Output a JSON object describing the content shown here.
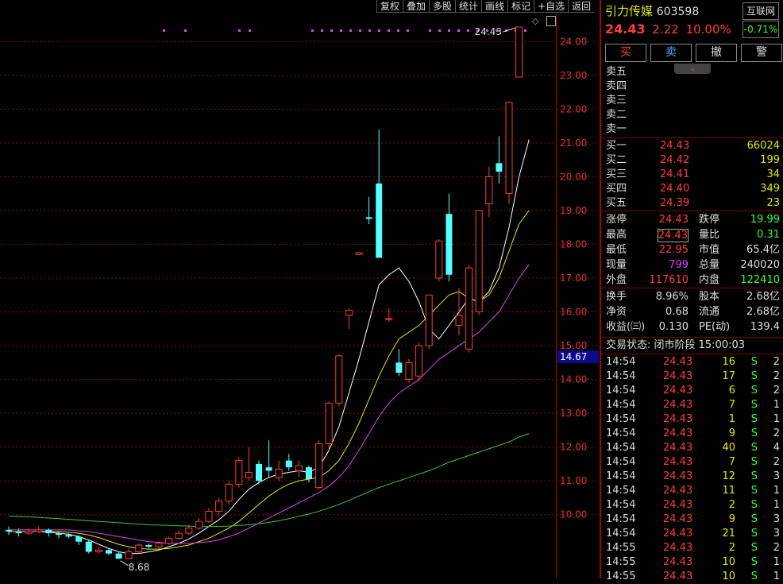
{
  "toolbar": [
    "复权",
    "叠加",
    "多股",
    "统计",
    "画线",
    "标记",
    "+自选",
    "返回"
  ],
  "stock": {
    "name": "引力传媒",
    "code": "603598",
    "price": "24.43",
    "change": "2.22",
    "pct": "10.00%",
    "index_name": "互联网",
    "index_pct": "-0.71%"
  },
  "trade_buttons": [
    "买",
    "卖",
    "撤",
    "警"
  ],
  "sell_levels": [
    "卖五",
    "卖四",
    "卖三",
    "卖二",
    "卖一"
  ],
  "buy_levels": [
    {
      "label": "买一",
      "price": "24.43",
      "vol": "66024"
    },
    {
      "label": "买二",
      "price": "24.42",
      "vol": "199"
    },
    {
      "label": "买三",
      "price": "24.41",
      "vol": "34"
    },
    {
      "label": "买四",
      "price": "24.40",
      "vol": "349"
    },
    {
      "label": "买五",
      "price": "24.39",
      "vol": "23"
    }
  ],
  "stats1": [
    {
      "k1": "涨停",
      "v1": "24.43",
      "c1": "red",
      "k2": "跌停",
      "v2": "19.99",
      "c2": "green"
    },
    {
      "k1": "最高",
      "v1": "24.43",
      "c1": "red",
      "k2": "量比",
      "v2": "0.31",
      "c2": "green"
    },
    {
      "k1": "最低",
      "v1": "22.95",
      "c1": "red",
      "k2": "市值",
      "v2": "65.4亿",
      "c2": "white"
    },
    {
      "k1": "现量",
      "v1": "799",
      "c1": "purple",
      "k2": "总量",
      "v2": "240020",
      "c2": "white"
    },
    {
      "k1": "外盘",
      "v1": "117610",
      "c1": "red",
      "k2": "内盘",
      "v2": "122410",
      "c2": "green"
    }
  ],
  "stats2": [
    {
      "k1": "换手",
      "v1": "8.96%",
      "k2": "股本",
      "v2": "2.68亿"
    },
    {
      "k1": "净资",
      "v1": "0.68",
      "k2": "流通",
      "v2": "2.68亿"
    },
    {
      "k1": "收益(㈢)",
      "v1": "0.130",
      "k2": "PE(动)",
      "v2": "139.4"
    }
  ],
  "trade_status": "交易状态: 闭市阶段 15:00:03",
  "ticks": [
    {
      "t": "14:54",
      "p": "24.43",
      "v": "16",
      "s": "S",
      "n": "2"
    },
    {
      "t": "14:54",
      "p": "24.43",
      "v": "17",
      "s": "S",
      "n": "2"
    },
    {
      "t": "14:54",
      "p": "24.43",
      "v": "6",
      "s": "S",
      "n": "2"
    },
    {
      "t": "14:54",
      "p": "24.43",
      "v": "7",
      "s": "S",
      "n": "1"
    },
    {
      "t": "14:54",
      "p": "24.43",
      "v": "1",
      "s": "S",
      "n": "1"
    },
    {
      "t": "14:54",
      "p": "24.43",
      "v": "9",
      "s": "S",
      "n": "2"
    },
    {
      "t": "14:54",
      "p": "24.43",
      "v": "40",
      "s": "S",
      "n": "4"
    },
    {
      "t": "14:54",
      "p": "24.43",
      "v": "7",
      "s": "S",
      "n": "2"
    },
    {
      "t": "14:54",
      "p": "24.43",
      "v": "12",
      "s": "S",
      "n": "3"
    },
    {
      "t": "14:54",
      "p": "24.43",
      "v": "11",
      "s": "S",
      "n": "1"
    },
    {
      "t": "14:54",
      "p": "24.43",
      "v": "2",
      "s": "S",
      "n": "1"
    },
    {
      "t": "14:54",
      "p": "24.43",
      "v": "9",
      "s": "S",
      "n": "3"
    },
    {
      "t": "14:54",
      "p": "24.43",
      "v": "21",
      "s": "S",
      "n": "3"
    },
    {
      "t": "14:55",
      "p": "24.43",
      "v": "2",
      "s": "S",
      "n": "2"
    },
    {
      "t": "14:55",
      "p": "24.43",
      "v": "10",
      "s": "S",
      "n": "1"
    },
    {
      "t": "14:55",
      "p": "24.43",
      "v": "10",
      "s": "S",
      "n": "1"
    }
  ],
  "chart_data": {
    "type": "candlestick",
    "y_ticks": [
      10,
      11,
      12,
      13,
      14,
      15,
      16,
      17,
      18,
      19,
      20,
      21,
      22,
      23,
      24
    ],
    "ylim": [
      8.3,
      24.9
    ],
    "crosshair_price": "14.67",
    "high_label": "24.43",
    "low_label": "8.68",
    "candles": [
      {
        "o": 9.55,
        "c": 9.5,
        "h": 9.65,
        "l": 9.4
      },
      {
        "o": 9.5,
        "c": 9.45,
        "h": 9.6,
        "l": 9.35
      },
      {
        "o": 9.45,
        "c": 9.5,
        "h": 9.6,
        "l": 9.4
      },
      {
        "o": 9.5,
        "c": 9.55,
        "h": 9.65,
        "l": 9.45
      },
      {
        "o": 9.55,
        "c": 9.45,
        "h": 9.6,
        "l": 9.35
      },
      {
        "o": 9.45,
        "c": 9.4,
        "h": 9.5,
        "l": 9.3
      },
      {
        "o": 9.4,
        "c": 9.35,
        "h": 9.45,
        "l": 9.3
      },
      {
        "o": 9.35,
        "c": 9.2,
        "h": 9.4,
        "l": 9.1
      },
      {
        "o": 9.2,
        "c": 8.9,
        "h": 9.25,
        "l": 8.85
      },
      {
        "o": 8.9,
        "c": 8.95,
        "h": 9.05,
        "l": 8.85
      },
      {
        "o": 8.95,
        "c": 8.85,
        "h": 9.0,
        "l": 8.8
      },
      {
        "o": 8.85,
        "c": 8.7,
        "h": 8.9,
        "l": 8.68
      },
      {
        "o": 8.7,
        "c": 8.9,
        "h": 9.0,
        "l": 8.68
      },
      {
        "o": 8.9,
        "c": 9.1,
        "h": 9.15,
        "l": 8.85
      },
      {
        "o": 9.1,
        "c": 9.05,
        "h": 9.15,
        "l": 9.0
      },
      {
        "o": 9.05,
        "c": 9.15,
        "h": 9.2,
        "l": 9.0
      },
      {
        "o": 9.15,
        "c": 9.3,
        "h": 9.35,
        "l": 9.1
      },
      {
        "o": 9.3,
        "c": 9.45,
        "h": 9.55,
        "l": 9.25
      },
      {
        "o": 9.45,
        "c": 9.6,
        "h": 9.7,
        "l": 9.4
      },
      {
        "o": 9.6,
        "c": 9.8,
        "h": 9.9,
        "l": 9.55
      },
      {
        "o": 9.8,
        "c": 10.1,
        "h": 10.2,
        "l": 9.75
      },
      {
        "o": 10.1,
        "c": 10.4,
        "h": 10.5,
        "l": 10.0
      },
      {
        "o": 10.4,
        "c": 10.9,
        "h": 11.0,
        "l": 10.3
      },
      {
        "o": 10.9,
        "c": 11.6,
        "h": 11.7,
        "l": 10.8
      },
      {
        "o": 11.1,
        "c": 11.25,
        "h": 12.0,
        "l": 11.0
      },
      {
        "o": 11.5,
        "c": 11.0,
        "h": 11.6,
        "l": 10.9
      },
      {
        "o": 11.4,
        "c": 11.3,
        "h": 12.2,
        "l": 11.1
      },
      {
        "o": 11.1,
        "c": 11.35,
        "h": 11.6,
        "l": 11.0
      },
      {
        "o": 11.6,
        "c": 11.4,
        "h": 11.8,
        "l": 11.3
      },
      {
        "o": 11.3,
        "c": 11.45,
        "h": 11.6,
        "l": 11.1
      },
      {
        "o": 11.4,
        "c": 11.05,
        "h": 11.45,
        "l": 10.95
      },
      {
        "o": 10.8,
        "c": 12.1,
        "h": 12.2,
        "l": 10.75
      },
      {
        "o": 12.1,
        "c": 13.3,
        "h": 13.35,
        "l": 11.9
      },
      {
        "o": 13.3,
        "c": 14.7,
        "h": 14.75,
        "l": 13.2
      },
      {
        "o": 15.9,
        "c": 16.05,
        "h": 16.1,
        "l": 15.5
      },
      {
        "o": 17.7,
        "c": 17.75,
        "h": 17.75,
        "l": 17.7
      },
      {
        "o": 18.8,
        "c": 18.75,
        "h": 19.4,
        "l": 18.6
      },
      {
        "o": 19.8,
        "c": 17.6,
        "h": 21.4,
        "l": 17.6
      },
      {
        "o": 15.8,
        "c": 15.8,
        "h": 16.1,
        "l": 15.7
      },
      {
        "o": 14.5,
        "c": 14.2,
        "h": 14.9,
        "l": 14.1
      },
      {
        "o": 14.0,
        "c": 14.5,
        "h": 14.6,
        "l": 13.9
      },
      {
        "o": 14.1,
        "c": 15.0,
        "h": 15.1,
        "l": 13.95
      },
      {
        "o": 15.0,
        "c": 16.5,
        "h": 16.5,
        "l": 14.9
      },
      {
        "o": 17.0,
        "c": 18.1,
        "h": 18.15,
        "l": 16.9
      },
      {
        "o": 18.9,
        "c": 17.1,
        "h": 19.5,
        "l": 16.9
      },
      {
        "o": 15.6,
        "c": 15.9,
        "h": 16.7,
        "l": 15.3
      },
      {
        "o": 14.9,
        "c": 17.3,
        "h": 17.4,
        "l": 14.8
      },
      {
        "o": 16.0,
        "c": 19.0,
        "h": 19.0,
        "l": 15.9
      },
      {
        "o": 19.2,
        "c": 20.0,
        "h": 20.3,
        "l": 18.8
      },
      {
        "o": 20.4,
        "c": 20.15,
        "h": 21.2,
        "l": 19.8
      },
      {
        "o": 19.5,
        "c": 22.2,
        "h": 22.2,
        "l": 19.2
      },
      {
        "o": 22.95,
        "c": 24.43,
        "h": 24.43,
        "l": 22.95
      }
    ],
    "ma_series": [
      {
        "color": "#ffffff",
        "values": [
          9.5,
          9.5,
          9.5,
          9.5,
          9.48,
          9.45,
          9.42,
          9.35,
          9.25,
          9.12,
          9.0,
          8.9,
          8.85,
          8.85,
          8.9,
          8.95,
          9.05,
          9.15,
          9.28,
          9.45,
          9.65,
          9.85,
          10.1,
          10.45,
          10.75,
          10.95,
          11.1,
          11.2,
          11.25,
          11.3,
          11.25,
          11.4,
          11.9,
          12.6,
          13.6,
          14.6,
          15.7,
          16.8,
          17.1,
          17.3,
          16.9,
          16.3,
          15.5,
          15.2,
          15.6,
          16.0,
          16.4,
          16.3,
          16.6,
          17.3,
          18.5,
          20.0,
          21.1
        ]
      },
      {
        "color": "#e6e600",
        "values": [
          9.5,
          9.5,
          9.5,
          9.5,
          9.5,
          9.5,
          9.48,
          9.45,
          9.4,
          9.32,
          9.22,
          9.12,
          9.05,
          9.0,
          8.98,
          8.98,
          9.0,
          9.05,
          9.1,
          9.2,
          9.3,
          9.45,
          9.6,
          9.8,
          10.05,
          10.3,
          10.55,
          10.75,
          10.9,
          11.0,
          11.05,
          11.1,
          11.3,
          11.6,
          12.1,
          12.7,
          13.4,
          14.1,
          14.7,
          15.2,
          15.4,
          15.6,
          15.9,
          16.2,
          16.5,
          16.6,
          16.4,
          16.3,
          16.5,
          17.0,
          17.8,
          18.6,
          19.0
        ]
      },
      {
        "color": "#e040fb",
        "values": [
          9.55,
          9.55,
          9.55,
          9.55,
          9.55,
          9.55,
          9.55,
          9.52,
          9.5,
          9.45,
          9.4,
          9.35,
          9.3,
          9.25,
          9.2,
          9.18,
          9.15,
          9.15,
          9.15,
          9.17,
          9.2,
          9.25,
          9.35,
          9.45,
          9.6,
          9.75,
          9.9,
          10.05,
          10.2,
          10.35,
          10.5,
          10.65,
          10.85,
          11.1,
          11.45,
          11.9,
          12.4,
          12.9,
          13.3,
          13.6,
          13.8,
          14.0,
          14.3,
          14.6,
          14.8,
          15.0,
          15.2,
          15.4,
          15.7,
          16.0,
          16.5,
          17.0,
          17.4
        ]
      },
      {
        "color": "#33cc33",
        "values": [
          9.95,
          9.95,
          9.93,
          9.92,
          9.9,
          9.88,
          9.86,
          9.84,
          9.82,
          9.8,
          9.78,
          9.76,
          9.74,
          9.72,
          9.7,
          9.69,
          9.68,
          9.67,
          9.66,
          9.65,
          9.65,
          9.65,
          9.66,
          9.68,
          9.7,
          9.73,
          9.77,
          9.82,
          9.88,
          9.95,
          10.02,
          10.1,
          10.2,
          10.3,
          10.42,
          10.55,
          10.68,
          10.8,
          10.9,
          11.0,
          11.1,
          11.2,
          11.3,
          11.42,
          11.55,
          11.65,
          11.75,
          11.85,
          11.95,
          12.05,
          12.15,
          12.3,
          12.4
        ]
      }
    ],
    "marker_dots_x": [
      205,
      232,
      300,
      313,
      392,
      404,
      416,
      428,
      440,
      452,
      464,
      476,
      488,
      500,
      512,
      540,
      552,
      564,
      576,
      588,
      600,
      612,
      624,
      636,
      648,
      660
    ]
  }
}
